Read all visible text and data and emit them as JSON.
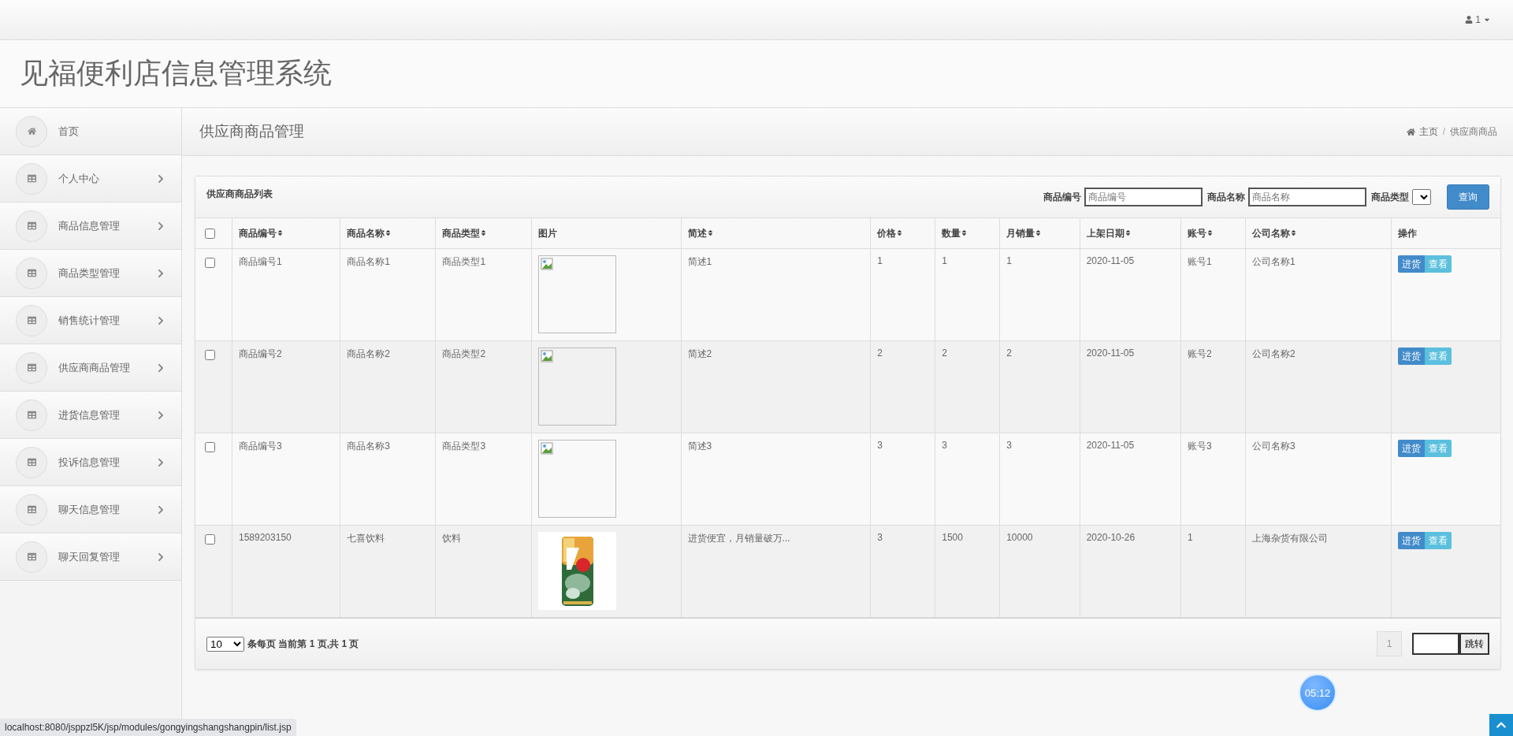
{
  "topbar": {
    "user": "1"
  },
  "header": {
    "title": "见福便利店信息管理系统"
  },
  "sidebar": {
    "items": [
      {
        "label": "首页",
        "kind": "home",
        "has_arrow": false
      },
      {
        "label": "个人中心",
        "kind": "table",
        "has_arrow": true
      },
      {
        "label": "商品信息管理",
        "kind": "table",
        "has_arrow": true
      },
      {
        "label": "商品类型管理",
        "kind": "table",
        "has_arrow": true
      },
      {
        "label": "销售统计管理",
        "kind": "table",
        "has_arrow": true
      },
      {
        "label": "供应商商品管理",
        "kind": "table",
        "has_arrow": true
      },
      {
        "label": "进货信息管理",
        "kind": "table",
        "has_arrow": true
      },
      {
        "label": "投诉信息管理",
        "kind": "table",
        "has_arrow": true
      },
      {
        "label": "聊天信息管理",
        "kind": "table",
        "has_arrow": true
      },
      {
        "label": "聊天回复管理",
        "kind": "table",
        "has_arrow": true
      }
    ]
  },
  "page": {
    "title": "供应商商品管理",
    "breadcrumb": [
      "主页",
      "/",
      "供应商商品"
    ]
  },
  "panel": {
    "title": "供应商商品列表",
    "filters": [
      {
        "kind": "text",
        "label": "商品编号",
        "placeholder": "商品编号"
      },
      {
        "kind": "text",
        "label": "商品名称",
        "placeholder": "商品名称"
      },
      {
        "kind": "select",
        "label": "商品类型"
      }
    ],
    "search_button": "查询"
  },
  "table": {
    "select_all_checked": false,
    "columns": [
      {
        "label": "商品编号",
        "sortable": true
      },
      {
        "label": "商品名称",
        "sortable": true
      },
      {
        "label": "商品类型",
        "sortable": true
      },
      {
        "label": "图片",
        "sortable": false
      },
      {
        "label": "简述",
        "sortable": true
      },
      {
        "label": "价格",
        "sortable": true
      },
      {
        "label": "数量",
        "sortable": true
      },
      {
        "label": "月销量",
        "sortable": true
      },
      {
        "label": "上架日期",
        "sortable": true
      },
      {
        "label": "账号",
        "sortable": true
      },
      {
        "label": "公司名称",
        "sortable": true
      },
      {
        "label": "操作",
        "sortable": false
      }
    ],
    "rows": [
      {
        "checked": false,
        "cells": [
          "商品编号1",
          "商品名称1",
          "商品类型1"
        ],
        "kind": "broken",
        "cells2": [
          "简述1",
          "1",
          "1",
          "1",
          "2020-11-05",
          "账号1",
          "公司名称1"
        ],
        "actions": [
          "进货",
          "查看"
        ]
      },
      {
        "checked": false,
        "cells": [
          "商品编号2",
          "商品名称2",
          "商品类型2"
        ],
        "kind": "broken",
        "cells2": [
          "简述2",
          "2",
          "2",
          "2",
          "2020-11-05",
          "账号2",
          "公司名称2"
        ],
        "actions": [
          "进货",
          "查看"
        ]
      },
      {
        "checked": false,
        "cells": [
          "商品编号3",
          "商品名称3",
          "商品类型3"
        ],
        "kind": "broken",
        "cells2": [
          "简述3",
          "3",
          "3",
          "3",
          "2020-11-05",
          "账号3",
          "公司名称3"
        ],
        "actions": [
          "进货",
          "查看"
        ]
      },
      {
        "checked": false,
        "cells": [
          "1589203150",
          "七喜饮料",
          "饮料"
        ],
        "kind": "picture",
        "cells2": [
          "进货便宜，月销量破万...",
          "3",
          "1500",
          "10000",
          "2020-10-26",
          "1",
          "上海杂货有限公司"
        ],
        "actions": [
          "进货",
          "查看"
        ]
      }
    ]
  },
  "pagination": {
    "page_size": "10",
    "info": "条每页 当前第 **1** 页,共 **1** 页",
    "pages": [
      "1"
    ],
    "jump_button": "跳转"
  },
  "timer": "05:12",
  "status_url": "localhost:8080/jsppzl5K/jsp/modules/gongyingshangshangpin/list.jsp"
}
